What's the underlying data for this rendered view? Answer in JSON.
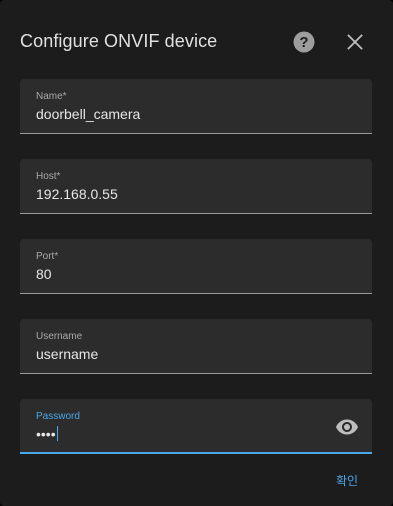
{
  "dialog": {
    "title": "Configure ONVIF device",
    "help_icon": "help-circle-icon",
    "close_icon": "close-icon"
  },
  "fields": {
    "name": {
      "label": "Name*",
      "value": "doorbell_camera"
    },
    "host": {
      "label": "Host*",
      "value": "192.168.0.55"
    },
    "port": {
      "label": "Port*",
      "value": "80"
    },
    "username": {
      "label": "Username",
      "value": "username"
    },
    "password": {
      "label": "Password",
      "value": "••••",
      "toggle_icon": "eye-icon",
      "focused": true
    }
  },
  "actions": {
    "confirm_label": "확인"
  },
  "colors": {
    "accent": "#4aa6e8",
    "dialog_background": "#1c1c1c",
    "field_background": "#2c2c2c"
  }
}
